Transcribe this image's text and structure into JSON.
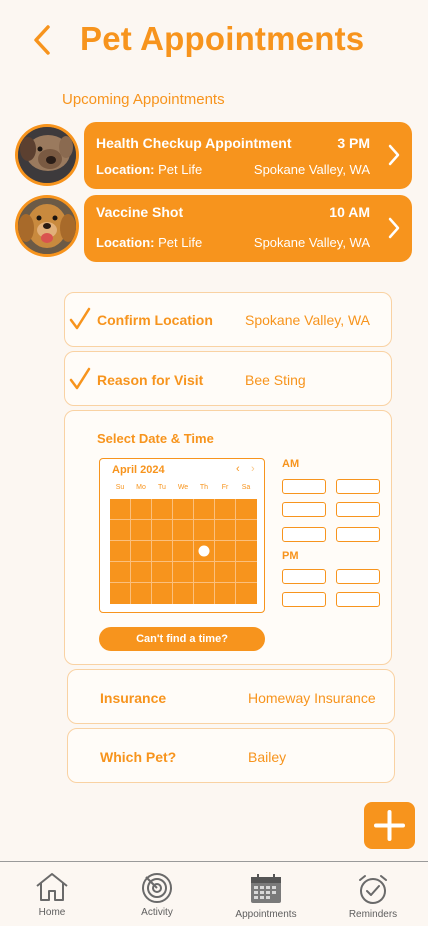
{
  "header": {
    "title": "Pet Appointments",
    "back_icon": "chevron-left-icon"
  },
  "upcoming": {
    "label": "Upcoming Appointments",
    "items": [
      {
        "title": "Health Checkup Appointment",
        "time": "3 PM",
        "location_label": "Location:",
        "location": "Pet Life",
        "city": "Spokane Valley, WA"
      },
      {
        "title": "Vaccine Shot",
        "time": "10 AM",
        "location_label": "Location:",
        "location": "Pet Life",
        "city": "Spokane Valley, WA"
      }
    ]
  },
  "confirm_location": {
    "label": "Confirm Location",
    "value": "Spokane Valley, WA"
  },
  "reason": {
    "label": "Reason for Visit",
    "value": "Bee Sting"
  },
  "schedule": {
    "label": "Select Date & Time",
    "month": "April 2024",
    "prev": "‹",
    "next": "›",
    "weekdays": [
      "Su",
      "Mo",
      "Tu",
      "We",
      "Th",
      "Fr",
      "Sa"
    ],
    "am_label": "AM",
    "pm_label": "PM",
    "cant_find": "Can't find a time?"
  },
  "insurance": {
    "label": "Insurance",
    "value": "Homeway Insurance"
  },
  "pet": {
    "label": "Which Pet?",
    "value": "Bailey"
  },
  "fab": {
    "icon": "plus-icon"
  },
  "nav": {
    "home": "Home",
    "activity": "Activity",
    "appointments": "Appointments",
    "reminders": "Reminders"
  },
  "colors": {
    "accent": "#f7941d",
    "background": "#fcf7f2",
    "border": "#f9d2a3"
  }
}
